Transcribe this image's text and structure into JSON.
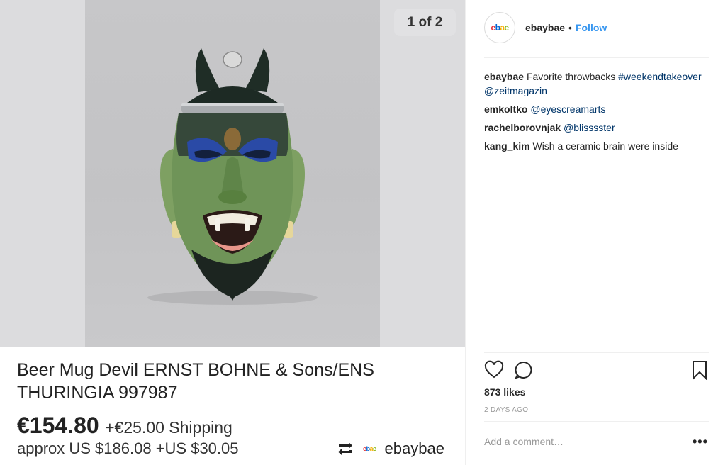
{
  "media": {
    "counter": "1 of 2",
    "listing": {
      "title": "Beer Mug Devil ERNST BOHNE & Sons/ENS THURINGIA 997987",
      "price": "€154.80",
      "shipping": "+€25.00 Shipping",
      "approx": "approx US $186.08 +US $30.05"
    },
    "repost": {
      "icon": "repost-icon",
      "user": "ebaybae",
      "logo": [
        "e",
        "b",
        "a",
        "e"
      ]
    }
  },
  "header": {
    "avatar_logo": [
      "e",
      "b",
      "a",
      "e"
    ],
    "username": "ebaybae",
    "separator": "•",
    "follow_label": "Follow"
  },
  "comments": [
    {
      "user": "ebaybae",
      "text": "Favorite throwbacks",
      "link": "#weekendtakeover @zeitmagazin"
    },
    {
      "user": "emkoltko",
      "text": "",
      "link": "@eyescreamarts"
    },
    {
      "user": "rachelborovnjak",
      "text": "",
      "link": "@blisssster"
    },
    {
      "user": "kang_kim",
      "text": "Wish a ceramic brain were inside",
      "link": ""
    }
  ],
  "actions": {
    "like_icon": "heart-icon",
    "comment_icon": "comment-bubble-icon",
    "save_icon": "bookmark-icon"
  },
  "likes": "873 likes",
  "date": "2 DAYS AGO",
  "add_comment_placeholder": "Add a comment…",
  "more_options": "•••",
  "colors": {
    "link": "#003569",
    "follow": "#3897f0",
    "ebay_red": "#e53238",
    "ebay_blue": "#0064d2",
    "ebay_yellow": "#f5af02",
    "ebay_green": "#86b817"
  }
}
